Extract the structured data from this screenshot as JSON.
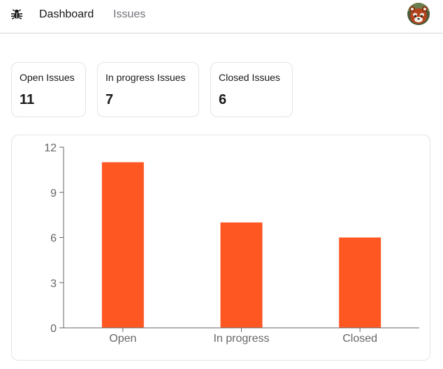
{
  "nav": {
    "logo_icon": "bug-icon",
    "links": [
      {
        "label": "Dashboard",
        "active": true
      },
      {
        "label": "Issues",
        "active": false
      }
    ],
    "avatar_icon": "red-panda-avatar"
  },
  "summary": [
    {
      "label": "Open Issues",
      "value": "11"
    },
    {
      "label": "In progress Issues",
      "value": "7"
    },
    {
      "label": "Closed Issues",
      "value": "6"
    }
  ],
  "chart_data": {
    "type": "bar",
    "categories": [
      "Open",
      "In progress",
      "Closed"
    ],
    "values": [
      11,
      7,
      6
    ],
    "ylim": [
      0,
      12
    ],
    "yticks": [
      0,
      3,
      6,
      9,
      12
    ],
    "bar_color": "#ff5722",
    "axis_color": "#666666",
    "grid": false,
    "title": "",
    "xlabel": "",
    "ylabel": ""
  },
  "colors": {
    "text": "#18181b",
    "muted": "#71717a",
    "border": "#e4e4e7",
    "accent": "#ff5722"
  }
}
